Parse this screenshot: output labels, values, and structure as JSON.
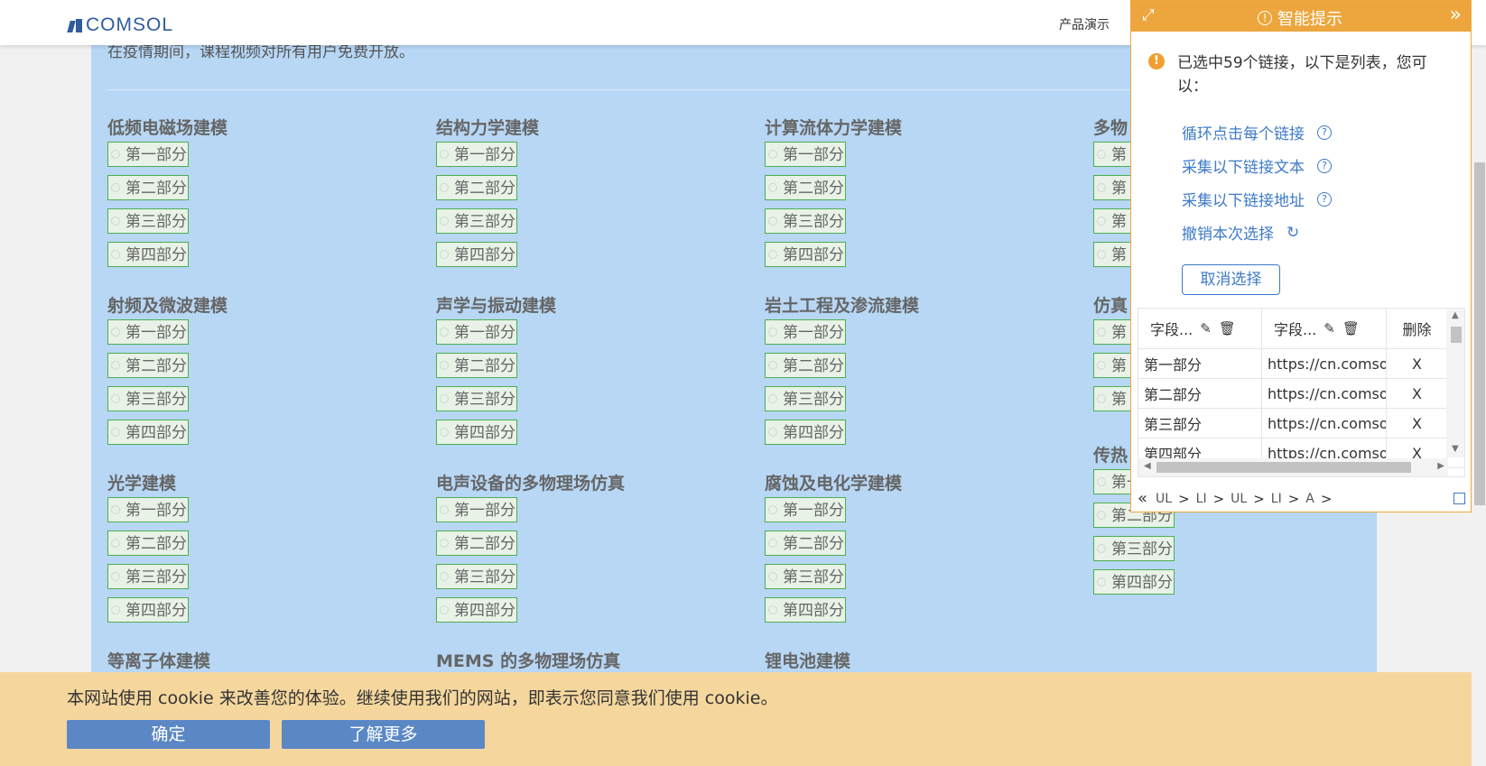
{
  "header": {
    "brand": "COMSOL",
    "nav_link": "产品演示"
  },
  "main": {
    "notice": "在疫情期间，课程视频对所有用户免费开放。",
    "sections": [
      {
        "title": "低频电磁场建模",
        "parts": [
          "第一部分",
          "第二部分",
          "第三部分",
          "第四部分"
        ]
      },
      {
        "title": "结构力学建模",
        "parts": [
          "第一部分",
          "第二部分",
          "第三部分",
          "第四部分"
        ]
      },
      {
        "title": "计算流体力学建模",
        "parts": [
          "第一部分",
          "第二部分",
          "第三部分",
          "第四部分"
        ]
      },
      {
        "title": "多物",
        "parts": [
          "第",
          "第",
          "第",
          "第"
        ]
      },
      {
        "title": "射频及微波建模",
        "parts": [
          "第一部分",
          "第二部分",
          "第三部分",
          "第四部分"
        ]
      },
      {
        "title": "声学与振动建模",
        "parts": [
          "第一部分",
          "第二部分",
          "第三部分",
          "第四部分"
        ]
      },
      {
        "title": "岩土工程及渗流建模",
        "parts": [
          "第一部分",
          "第二部分",
          "第三部分",
          "第四部分"
        ]
      },
      {
        "title": "仿真",
        "parts": [
          "第",
          "第",
          "第"
        ]
      },
      {
        "title": "光学建模",
        "parts": [
          "第一部分",
          "第二部分",
          "第三部分",
          "第四部分"
        ]
      },
      {
        "title": "电声设备的多物理场仿真",
        "parts": [
          "第一部分",
          "第二部分",
          "第三部分",
          "第四部分"
        ]
      },
      {
        "title": "腐蚀及电化学建模",
        "parts": [
          "第一部分",
          "第二部分",
          "第三部分",
          "第四部分"
        ]
      },
      {
        "title": "传热",
        "parts": [
          "第一部分",
          "第二部分",
          "第三部分",
          "第四部分"
        ]
      },
      {
        "title": "等离子体建模",
        "parts": []
      },
      {
        "title": "MEMS 的多物理场仿真",
        "parts": []
      },
      {
        "title": "锂电池建模",
        "parts": []
      }
    ]
  },
  "panel": {
    "title": "智能提示",
    "message": "已选中59个链接，以下是列表，您可以：",
    "actions": {
      "loop_click": "循环点击每个链接",
      "collect_text": "采集以下链接文本",
      "collect_url": "采集以下链接地址",
      "undo": "撤销本次选择"
    },
    "cancel_label": "取消选择",
    "table": {
      "col1": "字段...",
      "col2": "字段...",
      "col3": "删除",
      "rows": [
        {
          "text": "第一部分",
          "url": "https://cn.comso",
          "del": "X"
        },
        {
          "text": "第二部分",
          "url": "https://cn.comso",
          "del": "X"
        },
        {
          "text": "第三部分",
          "url": "https://cn.comso",
          "del": "X"
        },
        {
          "text": "第四部分",
          "url": "https://cn.comso",
          "del": "X"
        }
      ]
    },
    "breadcrumb": [
      "UL",
      "LI",
      "UL",
      "LI",
      "A"
    ]
  },
  "cookie": {
    "text": "本网站使用 cookie 来改善您的体验。继续使用我们的网站，即表示您同意我们使用 cookie。",
    "ok_label": "确定",
    "more_label": "了解更多"
  },
  "colors": {
    "selection_bg": "#b7d7f5",
    "panel_accent": "#eda63d",
    "link_blue": "#3d7ac9",
    "cookie_bg": "#f5d79e",
    "cookie_button": "#5b88c5"
  }
}
